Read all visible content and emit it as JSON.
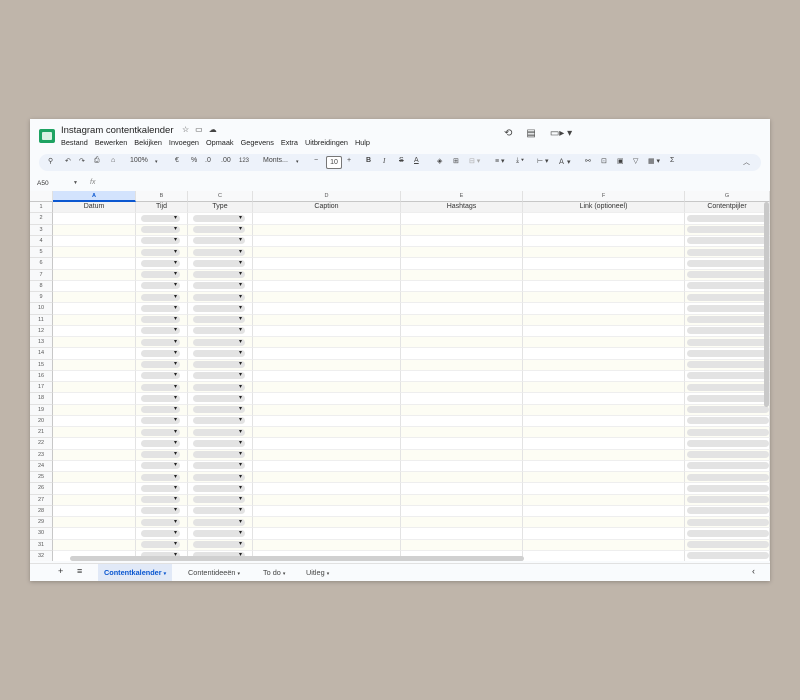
{
  "doc": {
    "title": "Instagram contentkalender"
  },
  "title_icons": [
    "star-icon",
    "move-to-folder-icon",
    "cloud-status-icon"
  ],
  "menu": [
    "Bestand",
    "Bewerken",
    "Bekijken",
    "Invoegen",
    "Opmaak",
    "Gegevens",
    "Extra",
    "Uitbreidingen",
    "Hulp"
  ],
  "right_icons": [
    "history-icon",
    "comment-icon",
    "video-call-icon"
  ],
  "toolbar": {
    "zoom": "100%",
    "currency": "€",
    "percent": "%",
    "dec_decrease": ".0",
    "dec_increase": ".00",
    "number_format": "123",
    "font": "Monts...",
    "minus": "−",
    "font_size": "10",
    "plus": "+",
    "bold": "B",
    "italic": "I",
    "strike": "S",
    "text_color": "A"
  },
  "namebox": {
    "value": "A50",
    "fx": "fx"
  },
  "columns": [
    "A",
    "B",
    "C",
    "D",
    "E",
    "F",
    "G"
  ],
  "header_row": [
    "Datum",
    "Tijd",
    "Type",
    "Caption",
    "Hashtags",
    "Link (optioneel)",
    "Contentpijler"
  ],
  "row_numbers": [
    "1",
    "2",
    "3",
    "4",
    "5",
    "6",
    "7",
    "8",
    "9",
    "10",
    "11",
    "12",
    "13",
    "14",
    "15",
    "16",
    "17",
    "18",
    "19",
    "20",
    "21",
    "22",
    "23",
    "24",
    "25",
    "26",
    "27",
    "28",
    "29",
    "30",
    "31",
    "32"
  ],
  "sheets": [
    {
      "label": "Contentkalender",
      "active": true
    },
    {
      "label": "Contentideeën",
      "active": false
    },
    {
      "label": "To do",
      "active": false
    },
    {
      "label": "Uitleg",
      "active": false
    }
  ],
  "sheet_buttons": {
    "add": "+",
    "list": "≡",
    "nav": "‹"
  },
  "colors": {
    "accent": "#0b57d0",
    "selected_header": "#d3e3fd",
    "logo": "#1ea362",
    "toolbar_bg": "#edf2fa"
  }
}
